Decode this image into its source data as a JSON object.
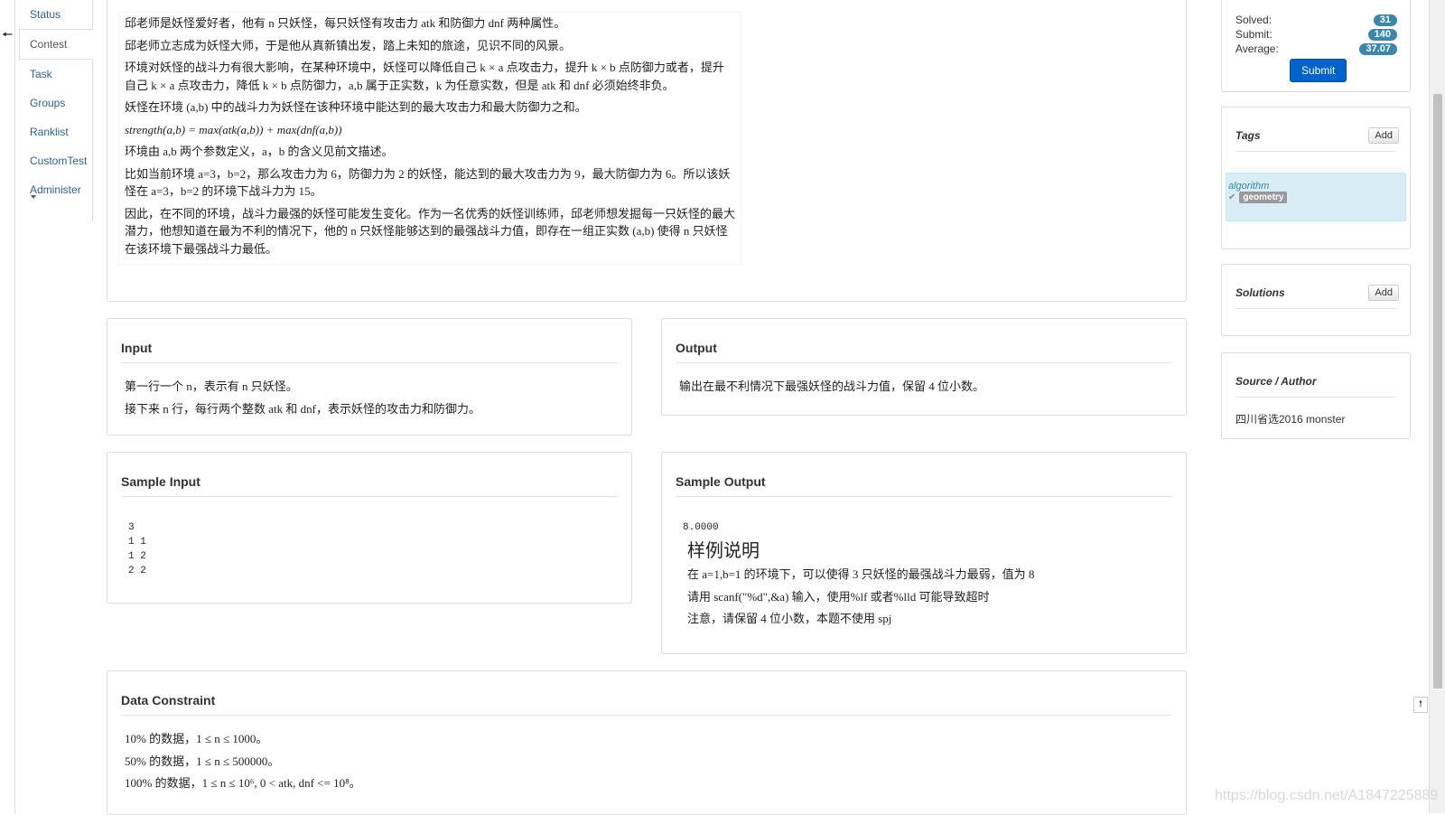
{
  "nav": {
    "items": [
      {
        "label": "Status"
      },
      {
        "label": "Contest"
      },
      {
        "label": "Task"
      },
      {
        "label": "Groups"
      },
      {
        "label": "Ranklist"
      },
      {
        "label": "CustomTest"
      },
      {
        "label": "Administer"
      }
    ],
    "active_index": 1
  },
  "description": {
    "paragraphs": [
      "邱老师是妖怪爱好者，他有 n 只妖怪，每只妖怪有攻击力 atk 和防御力 dnf 两种属性。",
      "邱老师立志成为妖怪大师，于是他从真新镇出发，踏上未知的旅途，见识不同的风景。",
      "环境对妖怪的战斗力有很大影响，在某种环境中，妖怪可以降低自己 k × a 点攻击力，提升 k × b 点防御力或者，提升自己 k × a 点攻击力，降低 k × b 点防御力，a,b 属于正实数，k 为任意实数，但是 atk 和 dnf 必须始终非负。",
      "妖怪在环境 (a,b) 中的战斗力为妖怪在该种环境中能达到的最大攻击力和最大防御力之和。",
      "strength(a,b) = max(atk(a,b)) + max(dnf(a,b))",
      "环境由 a,b 两个参数定义，a，b 的含义见前文描述。",
      "比如当前环境 a=3，b=2，那么攻击力为 6，防御力为 2 的妖怪，能达到的最大攻击力为 9，最大防御力为 6。所以该妖怪在 a=3，b=2 的环境下战斗力为 15。",
      "因此，在不同的环境，战斗力最强的妖怪可能发生变化。作为一名优秀的妖怪训练师，邱老师想发掘每一只妖怪的最大潜力，他想知道在最为不利的情况下，他的 n 只妖怪能够达到的最强战斗力值，即存在一组正实数 (a,b) 使得 n 只妖怪在该环境下最强战斗力最低。"
    ]
  },
  "input": {
    "title": "Input",
    "lines": [
      "第一行一个 n，表示有 n 只妖怪。",
      "接下来 n 行，每行两个整数 atk 和 dnf，表示妖怪的攻击力和防御力。"
    ]
  },
  "output": {
    "title": "Output",
    "text": "输出在最不利情况下最强妖怪的战斗力值，保留 4 位小数。"
  },
  "sample_input": {
    "title": "Sample Input",
    "text": "3\n1 1\n1 2\n2 2"
  },
  "sample_output": {
    "title": "Sample Output",
    "value": "8.0000",
    "explain_title": "样例说明",
    "lines": [
      "在 a=1,b=1 的环境下，可以使得 3 只妖怪的最强战斗力最弱，值为 8",
      "请用 scanf(\"%d\",&a) 输入，使用%lf 或者%lld 可能导致超时",
      "注意，请保留 4 位小数，本题不使用 spj"
    ]
  },
  "data_constraint": {
    "title": "Data Constraint",
    "lines": [
      "10% 的数据，1 ≤ n ≤ 1000。",
      "50% 的数据，1 ≤ n ≤ 500000。",
      "100% 的数据，1 ≤ n ≤ 10⁶, 0 < atk, dnf <= 10⁸。"
    ]
  },
  "stats": {
    "solved_label": "Solved:",
    "solved": "31",
    "submit_label": "Submit:",
    "submit": "140",
    "average_label": "Average:",
    "average": "37.07",
    "submit_button": "Submit"
  },
  "tags": {
    "title": "Tags",
    "add_label": "Add",
    "category": "algorithm",
    "tag": "geometry"
  },
  "solutions": {
    "title": "Solutions",
    "add_label": "Add"
  },
  "source": {
    "title": "Source / Author",
    "text": "四川省选2016 monster"
  },
  "watermark": "https://blog.csdn.net/A1847225889",
  "colors": {
    "link": "#2a6496",
    "badge": "#3a87ad",
    "primary_button": "#0063cc",
    "tag_bg": "#d9edf7"
  }
}
